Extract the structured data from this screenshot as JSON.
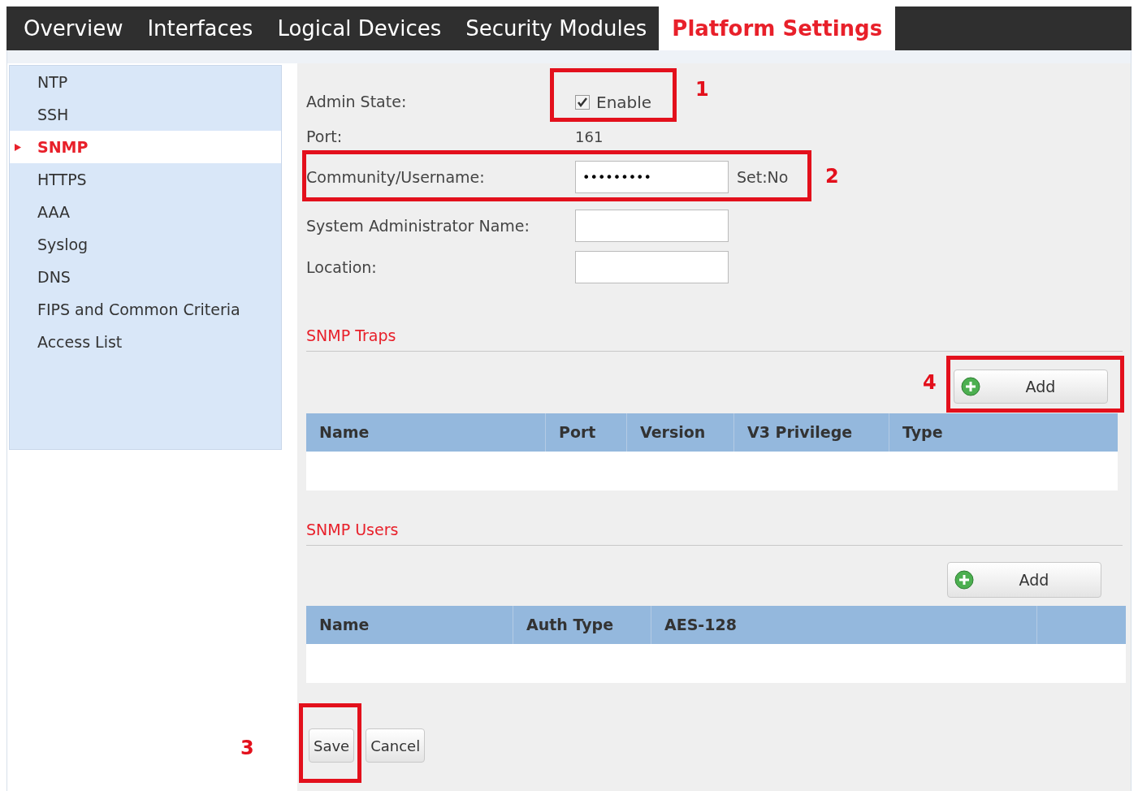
{
  "tabs": [
    {
      "label": "Overview",
      "selected": false
    },
    {
      "label": "Interfaces",
      "selected": false
    },
    {
      "label": "Logical Devices",
      "selected": false
    },
    {
      "label": "Security Modules",
      "selected": false
    },
    {
      "label": "Platform Settings",
      "selected": true
    }
  ],
  "sidebar": {
    "items": [
      {
        "label": "NTP",
        "selected": false
      },
      {
        "label": "SSH",
        "selected": false
      },
      {
        "label": "SNMP",
        "selected": true
      },
      {
        "label": "HTTPS",
        "selected": false
      },
      {
        "label": "AAA",
        "selected": false
      },
      {
        "label": "Syslog",
        "selected": false
      },
      {
        "label": "DNS",
        "selected": false
      },
      {
        "label": "FIPS and Common Criteria",
        "selected": false
      },
      {
        "label": "Access List",
        "selected": false
      }
    ]
  },
  "form": {
    "admin_state": {
      "label": "Admin State:",
      "checkbox_label": "Enable",
      "checked": true
    },
    "port": {
      "label": "Port:",
      "value": "161"
    },
    "community": {
      "label": "Community/Username:",
      "value": "•••••••••",
      "status": "Set:No"
    },
    "sys_admin_name": {
      "label": "System Administrator Name:"
    },
    "location": {
      "label": "Location:"
    }
  },
  "snmp_traps": {
    "title": "SNMP Traps",
    "add_button": "Add",
    "columns": [
      "Name",
      "Port",
      "Version",
      "V3 Privilege",
      "Type"
    ]
  },
  "snmp_users": {
    "title": "SNMP Users",
    "add_button": "Add",
    "columns": [
      "Name",
      "Auth Type",
      "AES-128"
    ]
  },
  "buttons": [
    "Save",
    "Cancel"
  ],
  "annotations": [
    {
      "label": "1"
    },
    {
      "label": "2"
    },
    {
      "label": "3"
    },
    {
      "label": "4"
    }
  ]
}
